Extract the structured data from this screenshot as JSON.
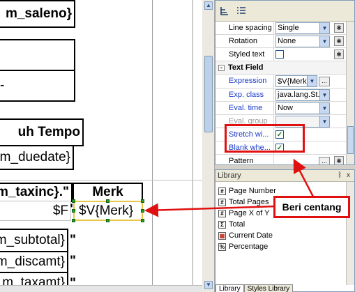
{
  "canvas": {
    "cells": [
      {
        "id": "saleno",
        "text": "m_saleno}"
      },
      {
        "id": "empty1",
        "text": ""
      },
      {
        "id": "empty2",
        "text": "-"
      },
      {
        "id": "jatuh_tempo",
        "text": "uh Tempo"
      },
      {
        "id": "duedate",
        "text": "m_duedate}"
      },
      {
        "id": "taxinc",
        "text": "m_taxinc}.\""
      },
      {
        "id": "merk_header",
        "text": "Merk"
      },
      {
        "id": "f_cell",
        "text": "$F"
      },
      {
        "id": "subtotal",
        "text": "m_subtotal}"
      },
      {
        "id": "discamt",
        "text": "m_discamt}"
      },
      {
        "id": "taxamt",
        "text": "m_taxamt}"
      }
    ],
    "quote_mark": "\"",
    "selected_field": "$V{Merk}"
  },
  "properties": {
    "rows": {
      "line_spacing": {
        "label": "Line spacing",
        "value": "Single"
      },
      "rotation": {
        "label": "Rotation",
        "value": "None"
      },
      "styled_text": {
        "label": "Styled text"
      },
      "expression": {
        "label": "Expression",
        "value": "$V{Merk}"
      },
      "exp_class": {
        "label": "Exp. class",
        "value": "java.lang.St..."
      },
      "eval_time": {
        "label": "Eval. time",
        "value": "Now"
      },
      "eval_group": {
        "label": "Eval. group"
      },
      "stretch": {
        "label": "Stretch wi...",
        "checked": true
      },
      "blank": {
        "label": "Blank whe...",
        "checked": true
      },
      "pattern": {
        "label": "Pattern"
      }
    },
    "section_text_field": "Text Field",
    "dots_label": "...",
    "check_mark": "✓"
  },
  "library": {
    "title": "Library",
    "items": [
      "Page Number",
      "Total Pages",
      "Page X of Y",
      "Total",
      "Current Date",
      "Percentage"
    ],
    "icons": [
      "#",
      "#",
      "#",
      "Σ",
      "▦",
      "%"
    ],
    "tabs": [
      "Library",
      "Styles Library"
    ]
  },
  "annotation": {
    "callout": "Beri centang",
    "color": "#e01010"
  }
}
